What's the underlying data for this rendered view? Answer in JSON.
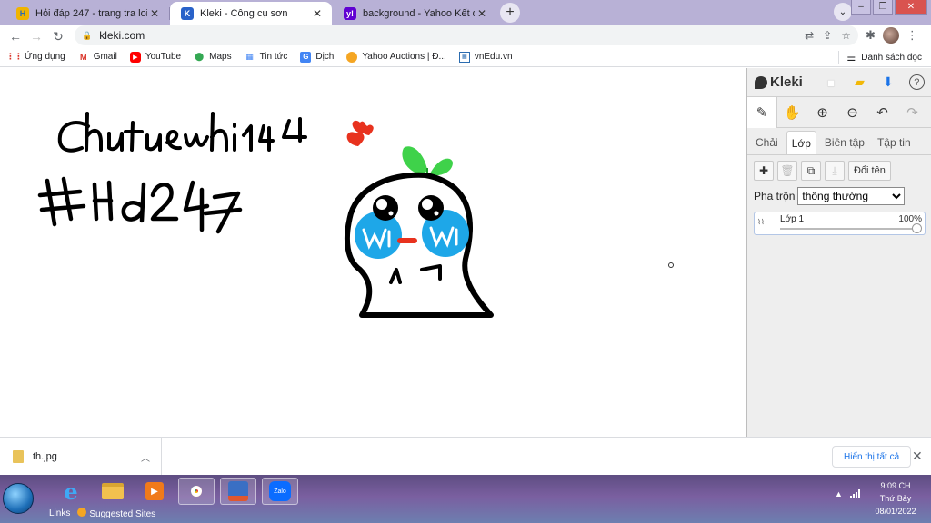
{
  "browser": {
    "tabs": [
      {
        "title": "Hỏi đáp 247 - trang tra loi",
        "icon": "hoidap-icon",
        "active": false
      },
      {
        "title": "Kleki - Công cụ sơn",
        "icon": "kleki-icon",
        "active": true
      },
      {
        "title": "background - Yahoo Kết quả Tìm",
        "icon": "yahoo-icon",
        "active": false
      }
    ],
    "url": "kleki.com",
    "bookmarks": [
      {
        "label": "Ứng dụng",
        "icon": "apps-grid-icon"
      },
      {
        "label": "Gmail",
        "icon": "gmail-icon"
      },
      {
        "label": "YouTube",
        "icon": "youtube-icon"
      },
      {
        "label": "Maps",
        "icon": "maps-icon"
      },
      {
        "label": "Tin tức",
        "icon": "news-icon"
      },
      {
        "label": "Dịch",
        "icon": "translate-icon"
      },
      {
        "label": "Yahoo Auctions | Đ...",
        "icon": "yahoo-auctions-icon"
      },
      {
        "label": "vnEdu.vn",
        "icon": "vnedu-icon"
      }
    ],
    "reading_list": "Danh sách đọc"
  },
  "kleki": {
    "brand": "Kleki",
    "tabs": [
      "Chải",
      "Lớp",
      "Biên tập",
      "Tập tin"
    ],
    "active_tab": "Lớp",
    "rename_label": "Đổi tên",
    "blend_label": "Pha trộn",
    "blend_value": "thông thường",
    "layer": {
      "name": "Lớp 1",
      "opacity": "100%",
      "opacity_fraction": 1.0
    }
  },
  "downloads": {
    "file": "th.jpg",
    "show_all": "Hiển thị tất cả"
  },
  "taskbar": {
    "links_label": "Links",
    "suggested_sites": "Suggested Sites",
    "time": "9:09 CH",
    "day": "Thứ Bảy",
    "date": "08/01/2022",
    "zalo_label": "Zalo"
  },
  "colors": {
    "tabstrip": "#b8b1d6",
    "accent_blue": "#1a73e8",
    "sprout_green": "#3fd24a",
    "cheek_blue": "#1ea7e8",
    "heart_red": "#e8321e"
  }
}
